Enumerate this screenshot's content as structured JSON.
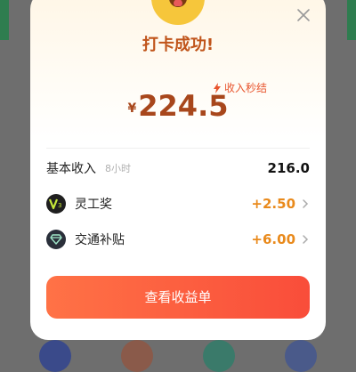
{
  "dialog": {
    "title": "打卡成功!",
    "tag": "收入秒结",
    "currency": "¥",
    "amount": "224.5",
    "rows": [
      {
        "label": "基本收入",
        "sub": "8小时",
        "value": "216.0"
      },
      {
        "label": "灵工奖",
        "value": "+2.50"
      },
      {
        "label": "交通补贴",
        "value": "+6.00"
      }
    ],
    "button_label": "查看收益单"
  },
  "colors": {
    "accent_title": "#c0541a",
    "amount": "#a8471c",
    "bonus": "#e98a1c",
    "button_start": "#ff7246",
    "button_end": "#f94d3a"
  },
  "icons": [
    "emoji-icon",
    "close-icon",
    "lightning-icon",
    "v3-badge-icon",
    "diamond-icon",
    "chevron-right-icon"
  ]
}
